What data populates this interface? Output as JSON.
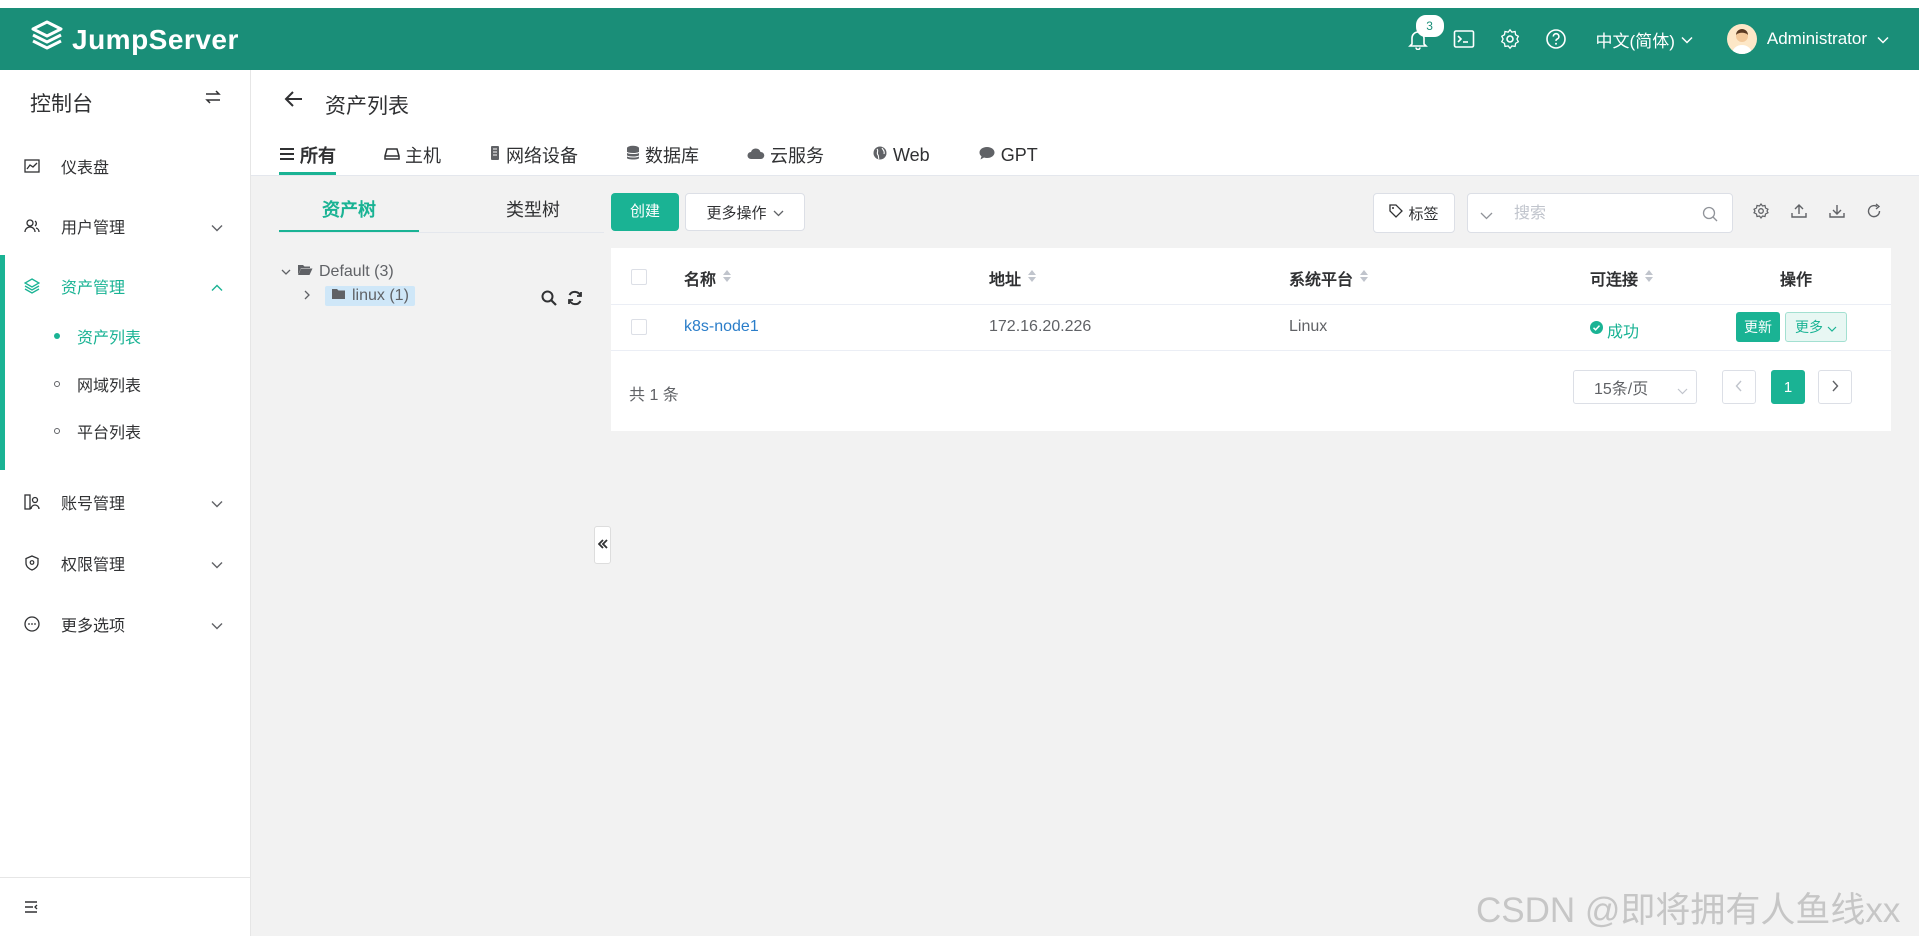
{
  "app": {
    "name": "JumpServer"
  },
  "header": {
    "notification_count": "3",
    "language": "中文(简体)",
    "user_name": "Administrator"
  },
  "sidebar": {
    "title": "控制台",
    "items": [
      {
        "label": "仪表盘"
      },
      {
        "label": "用户管理"
      },
      {
        "label": "资产管理"
      },
      {
        "label": "账号管理"
      },
      {
        "label": "权限管理"
      },
      {
        "label": "更多选项"
      }
    ],
    "sub_items": [
      {
        "label": "资产列表"
      },
      {
        "label": "网域列表"
      },
      {
        "label": "平台列表"
      }
    ]
  },
  "page": {
    "title": "资产列表",
    "tabs": [
      {
        "label": "所有"
      },
      {
        "label": "主机"
      },
      {
        "label": "网络设备"
      },
      {
        "label": "数据库"
      },
      {
        "label": "云服务"
      },
      {
        "label": "Web"
      },
      {
        "label": "GPT"
      }
    ]
  },
  "tree": {
    "tabs": [
      "资产树",
      "类型树"
    ],
    "root": "Default (3)",
    "child": "linux (1)"
  },
  "toolbar": {
    "create": "创建",
    "more_actions": "更多操作",
    "tags": "标签",
    "search_placeholder": "搜索"
  },
  "table": {
    "columns": [
      "名称",
      "地址",
      "系统平台",
      "可连接",
      "操作"
    ],
    "rows": [
      {
        "name": "k8s-node1",
        "address": "172.16.20.226",
        "platform": "Linux",
        "status": "成功",
        "update": "更新",
        "more": "更多"
      }
    ],
    "total": "共 1 条",
    "page_size": "15条/页",
    "current_page": "1"
  },
  "watermark": "CSDN @即将拥有人鱼线xx",
  "colors": {
    "header": "#1a8e78",
    "accent": "#1ab394",
    "link": "#2a7dc9"
  }
}
